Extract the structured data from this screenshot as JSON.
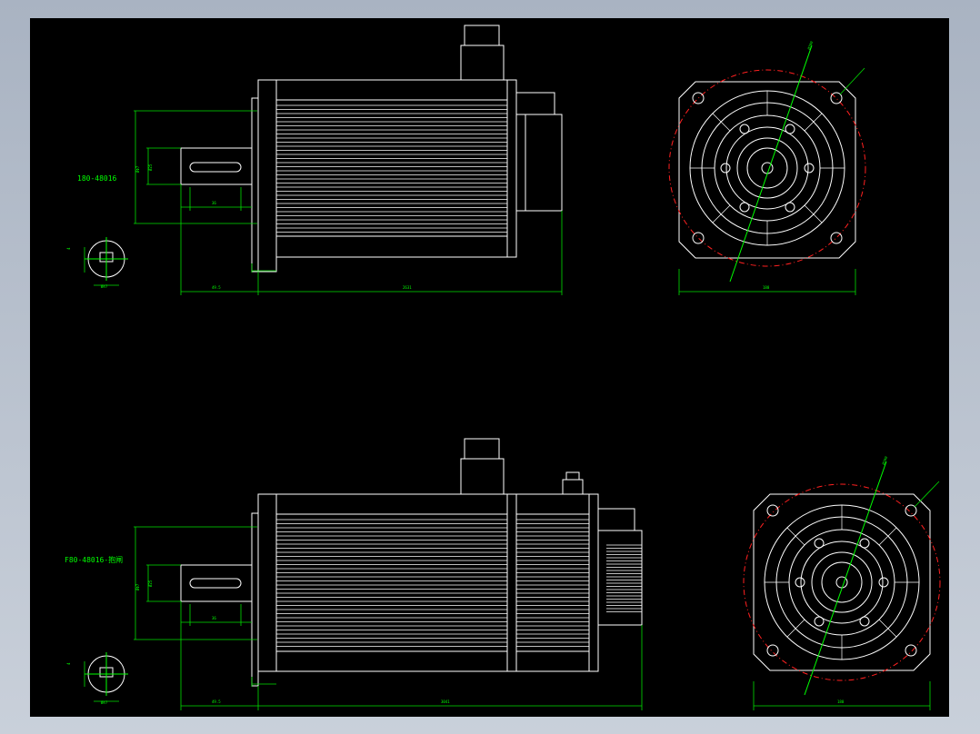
{
  "drawing": {
    "top_view": {
      "model_label": "180-48016"
    },
    "bottom_view": {
      "model_label": "F80-48016-抱闸"
    }
  },
  "colors": {
    "background": "#000000",
    "outline": "#ffffff",
    "dimension": "#00e000",
    "centerline": "#ff2020",
    "frame": "#b8c0cc"
  },
  "icons": [
    "motor-side-view",
    "motor-front-flange-view",
    "shaft-section-view"
  ]
}
